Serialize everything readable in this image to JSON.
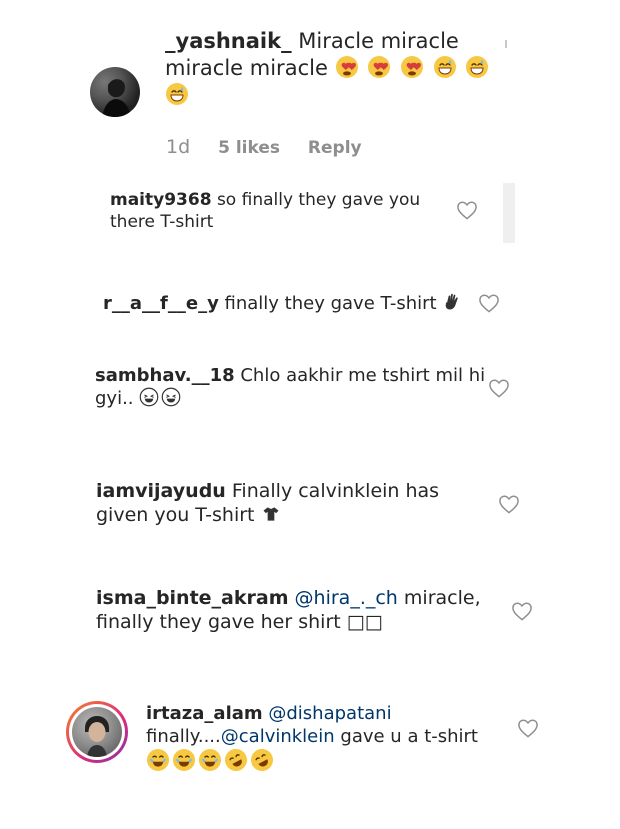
{
  "comments": [
    {
      "username": "_yashnaik_",
      "text": "Miracle miracle miracle miracle",
      "emojis": [
        "heart-eyes-emoji",
        "heart-eyes-emoji",
        "heart-eyes-emoji",
        "grinning-sweat-emoji",
        "grinning-sweat-emoji",
        "grinning-sweat-emoji"
      ],
      "time_ago": "1d",
      "likes": "5 likes",
      "reply_label": "Reply"
    },
    {
      "username": "maity9368",
      "text": "so finally they gave you there T-shirt"
    },
    {
      "username": "r__a__f__e_y",
      "text": "finally they gave T-shirt",
      "emoji": "waving-hand-emoji"
    },
    {
      "username": "sambhav.__18",
      "text": "Chlo aakhir me tshirt mil hi gyi..",
      "emojis": [
        "laughing-emoji",
        "laughing-emoji"
      ]
    },
    {
      "username": "iamvijayudu",
      "text": "Finally calvinklein has given you T-shirt",
      "emoji": "tshirt-emoji"
    },
    {
      "username": "isma_binte_akram",
      "mention": "@hira_._ch",
      "text": "miracle, finally they gave her shirt",
      "missing_glyphs": "□□"
    },
    {
      "username": "irtaza_alam",
      "mention1": "@dishapatani",
      "text_prefix": "finally....",
      "mention2": "@calvinklein",
      "text_suffix": "gave u a t-shirt",
      "emojis": [
        "laughing-emoji",
        "laughing-emoji",
        "laughing-emoji",
        "rofl-emoji",
        "rofl-emoji"
      ]
    }
  ],
  "colors": {
    "text": "#262626",
    "meta": "#8e8e8e",
    "mention": "#00376b",
    "story_ring_start": "#f58529",
    "story_ring_end": "#dd2a7b",
    "heart_stroke": "#8e8e8e"
  }
}
